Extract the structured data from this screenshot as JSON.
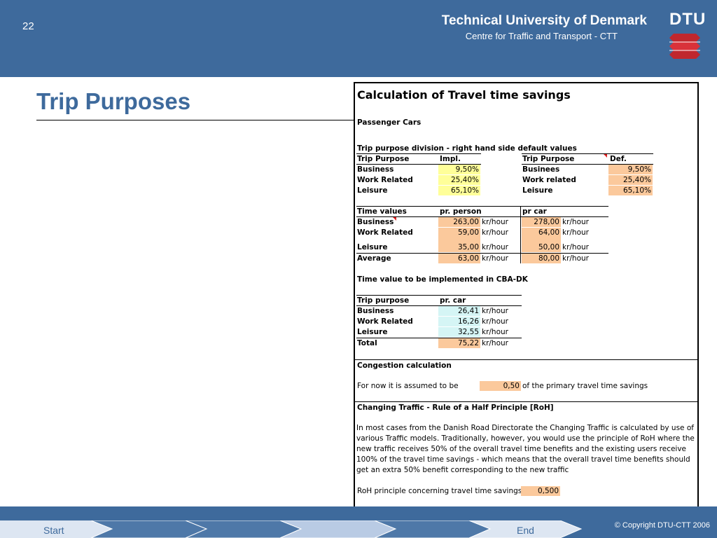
{
  "header": {
    "slide_number": "22",
    "university": "Technical University of Denmark",
    "centre": "Centre for Traffic and Transport - CTT",
    "logo_text": "DTU"
  },
  "title": "Trip Purposes",
  "sheet": {
    "title": "Calculation of Travel time savings",
    "section_label": "Passenger Cars",
    "division_title": "Trip purpose division - right hand side default values",
    "division": {
      "head_left": [
        "Trip Purpose",
        "Impl."
      ],
      "head_right": [
        "Trip Purpose",
        "Def."
      ],
      "rows": [
        {
          "left": "Business",
          "impl": "9,50%",
          "right": "Businees",
          "def": "9,50%"
        },
        {
          "left": "Work Related",
          "impl": "25,40%",
          "right": "Work related",
          "def": "25,40%"
        },
        {
          "left": "Leisure",
          "impl": "65,10%",
          "right": "Leisure",
          "def": "65,10%"
        }
      ]
    },
    "time_values": {
      "head": [
        "Time values",
        "pr. person",
        "pr car"
      ],
      "rows": [
        {
          "label": "Business",
          "person": "263,00",
          "car": "278,00"
        },
        {
          "label": "Work Related",
          "person": "59,00",
          "car": "64,00"
        },
        {
          "label": "Leisure",
          "person": "35,00",
          "car": "50,00"
        },
        {
          "label": "Average",
          "person": "63,00",
          "car": "80,00"
        }
      ],
      "unit": "kr/hour"
    },
    "implemented_title": "Time value to be implemented in CBA-DK",
    "implemented": {
      "head": [
        "Trip purpose",
        "pr. car"
      ],
      "rows": [
        {
          "label": "Business",
          "value": "26,41"
        },
        {
          "label": "Work Related",
          "value": "16,26"
        },
        {
          "label": "Leisure",
          "value": "32,55"
        },
        {
          "label": "Total",
          "value": "75,22"
        }
      ],
      "unit": "kr/hour"
    },
    "congestion": {
      "title": "Congestion calculation",
      "text": "For now it is assumed to be",
      "value": "0,50",
      "suffix": "of the primary travel time savings"
    },
    "roh": {
      "title": "Changing Traffic - Rule of a Half Principle [RoH]",
      "paragraph": "In most cases from the Danish Road Directorate the Changing Traffic is calculated by use of various Traffic models. Traditionally, however, you would use the principle of RoH where the new traffic receives 50% of the overall travel time benefits and the existing users receive 100% of the travel time savings - which means that the overall travel time benefits should get an extra 50% benefit corresponding to the new traffic",
      "label": "RoH principle concerning travel time savings",
      "value": "0,500"
    }
  },
  "footer": {
    "start": "Start",
    "end": "End",
    "copyright": "© Copyright DTU-CTT 2006"
  },
  "colors": {
    "brand_blue": "#3e6a9c",
    "input_yellow": "#ffff99",
    "value_orange": "#fbc99c",
    "calc_cyan": "#d5f5f5"
  }
}
